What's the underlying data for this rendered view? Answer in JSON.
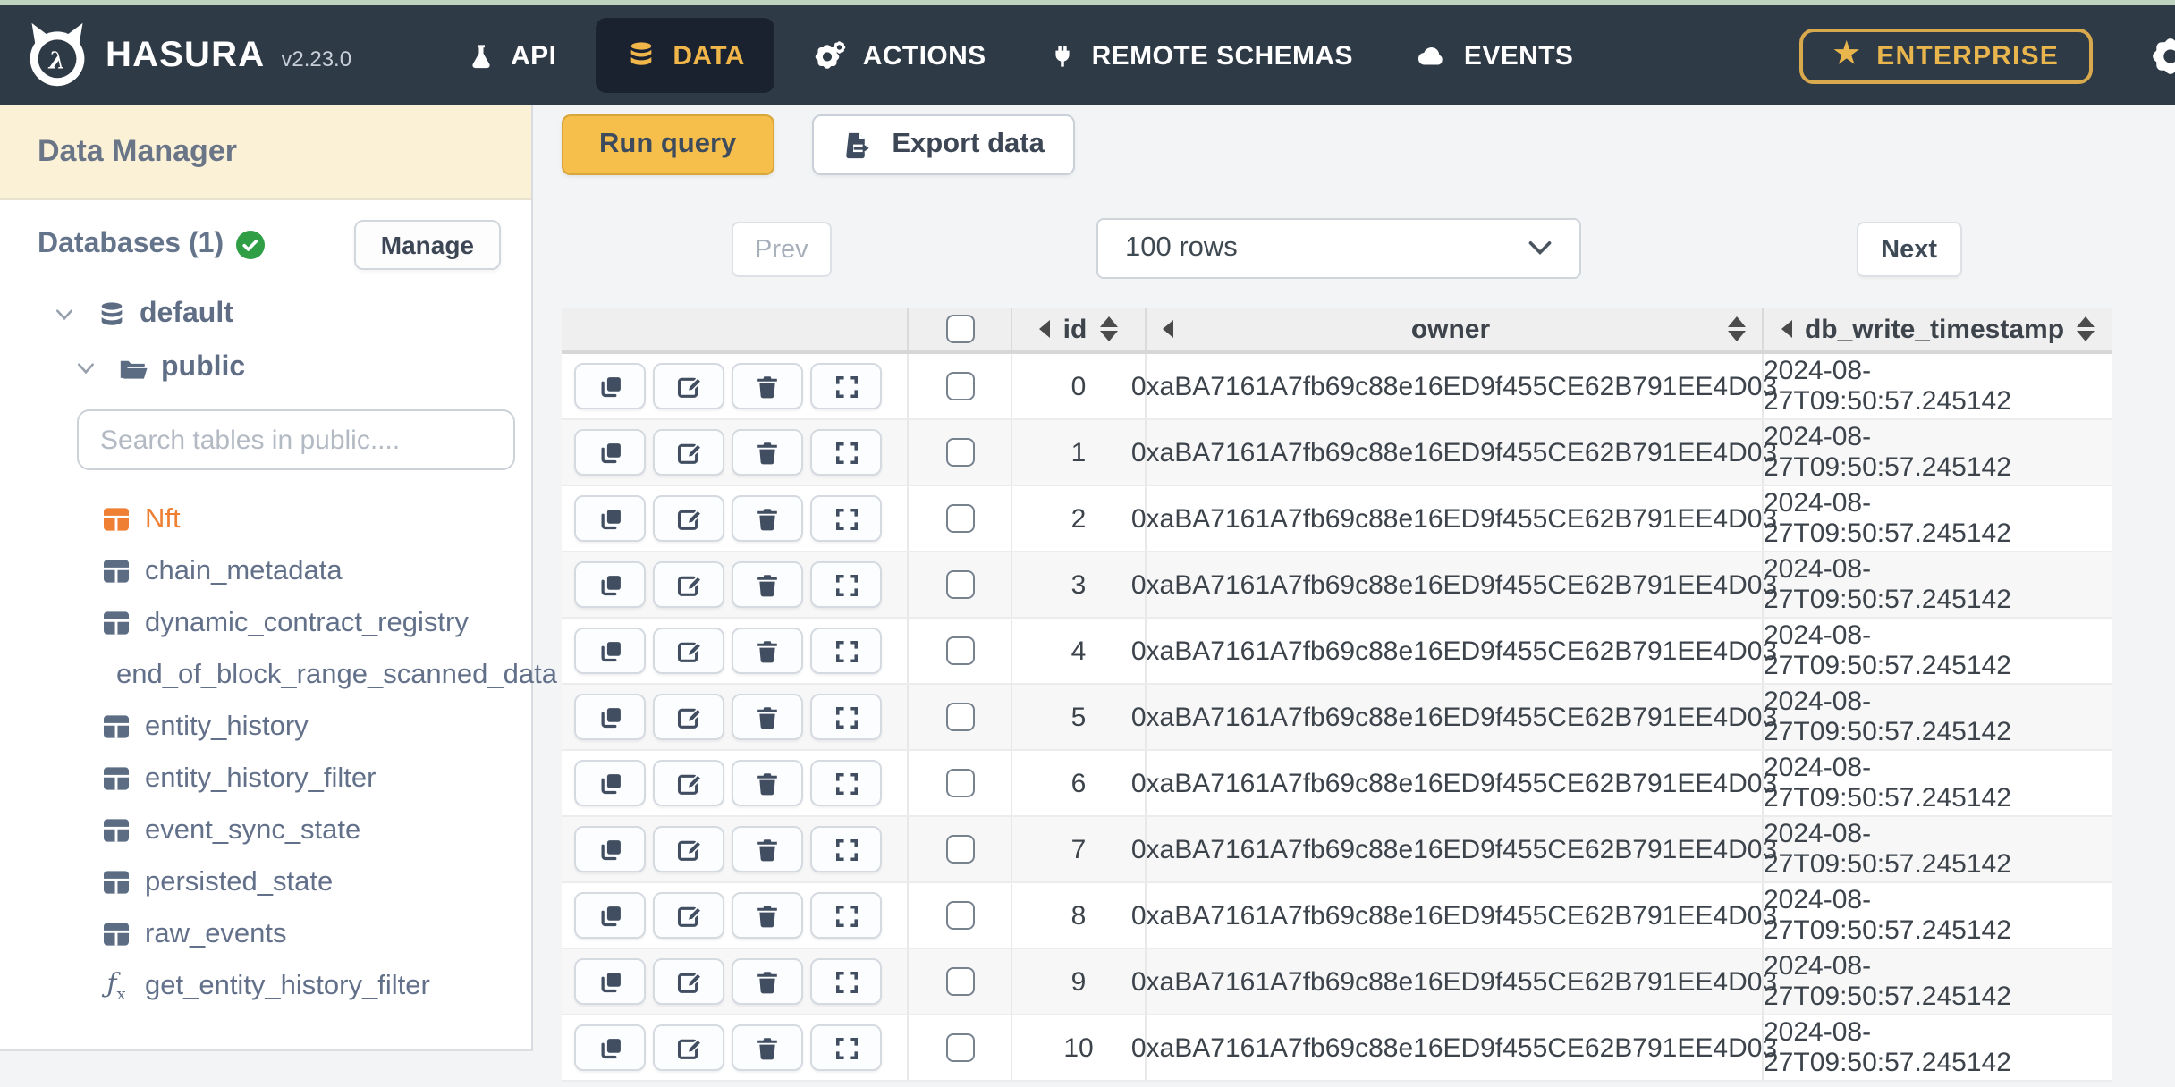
{
  "topbar": {
    "brand": "HASURA",
    "version": "v2.23.0",
    "nav": [
      {
        "label": "API"
      },
      {
        "label": "DATA",
        "active": true
      },
      {
        "label": "ACTIONS"
      },
      {
        "label": "REMOTE SCHEMAS"
      },
      {
        "label": "EVENTS"
      }
    ],
    "enterprise_label": "ENTERPRISE",
    "star_icon": "★"
  },
  "sidebar": {
    "title": "Data Manager",
    "databases_label": "Databases (1)",
    "manage_label": "Manage",
    "tree": {
      "database": "default",
      "schema": "public"
    },
    "search_placeholder": "Search tables in public....",
    "tables": [
      {
        "label": "Nft",
        "active": true
      },
      {
        "label": "chain_metadata"
      },
      {
        "label": "dynamic_contract_registry"
      },
      {
        "label": "end_of_block_range_scanned_data"
      },
      {
        "label": "entity_history"
      },
      {
        "label": "entity_history_filter"
      },
      {
        "label": "event_sync_state"
      },
      {
        "label": "persisted_state"
      },
      {
        "label": "raw_events"
      },
      {
        "label": "get_entity_history_filter",
        "type": "function"
      }
    ]
  },
  "toolbar": {
    "run_query": "Run query",
    "export_data": "Export data"
  },
  "pagination": {
    "prev": "Prev",
    "rows_selected": "100 rows",
    "next": "Next"
  },
  "table": {
    "columns": [
      "id",
      "owner",
      "db_write_timestamp"
    ],
    "rows": [
      {
        "id": "0",
        "owner": "0xaBA7161A7fb69c88e16ED9f455CE62B791EE4D03",
        "db_write_timestamp": "2024-08-27T09:50:57.245142"
      },
      {
        "id": "1",
        "owner": "0xaBA7161A7fb69c88e16ED9f455CE62B791EE4D03",
        "db_write_timestamp": "2024-08-27T09:50:57.245142"
      },
      {
        "id": "2",
        "owner": "0xaBA7161A7fb69c88e16ED9f455CE62B791EE4D03",
        "db_write_timestamp": "2024-08-27T09:50:57.245142"
      },
      {
        "id": "3",
        "owner": "0xaBA7161A7fb69c88e16ED9f455CE62B791EE4D03",
        "db_write_timestamp": "2024-08-27T09:50:57.245142"
      },
      {
        "id": "4",
        "owner": "0xaBA7161A7fb69c88e16ED9f455CE62B791EE4D03",
        "db_write_timestamp": "2024-08-27T09:50:57.245142"
      },
      {
        "id": "5",
        "owner": "0xaBA7161A7fb69c88e16ED9f455CE62B791EE4D03",
        "db_write_timestamp": "2024-08-27T09:50:57.245142"
      },
      {
        "id": "6",
        "owner": "0xaBA7161A7fb69c88e16ED9f455CE62B791EE4D03",
        "db_write_timestamp": "2024-08-27T09:50:57.245142"
      },
      {
        "id": "7",
        "owner": "0xaBA7161A7fb69c88e16ED9f455CE62B791EE4D03",
        "db_write_timestamp": "2024-08-27T09:50:57.245142"
      },
      {
        "id": "8",
        "owner": "0xaBA7161A7fb69c88e16ED9f455CE62B791EE4D03",
        "db_write_timestamp": "2024-08-27T09:50:57.245142"
      },
      {
        "id": "9",
        "owner": "0xaBA7161A7fb69c88e16ED9f455CE62B791EE4D03",
        "db_write_timestamp": "2024-08-27T09:50:57.245142"
      },
      {
        "id": "10",
        "owner": "0xaBA7161A7fb69c88e16ED9f455CE62B791EE4D03",
        "db_write_timestamp": "2024-08-27T09:50:57.245142"
      }
    ]
  }
}
